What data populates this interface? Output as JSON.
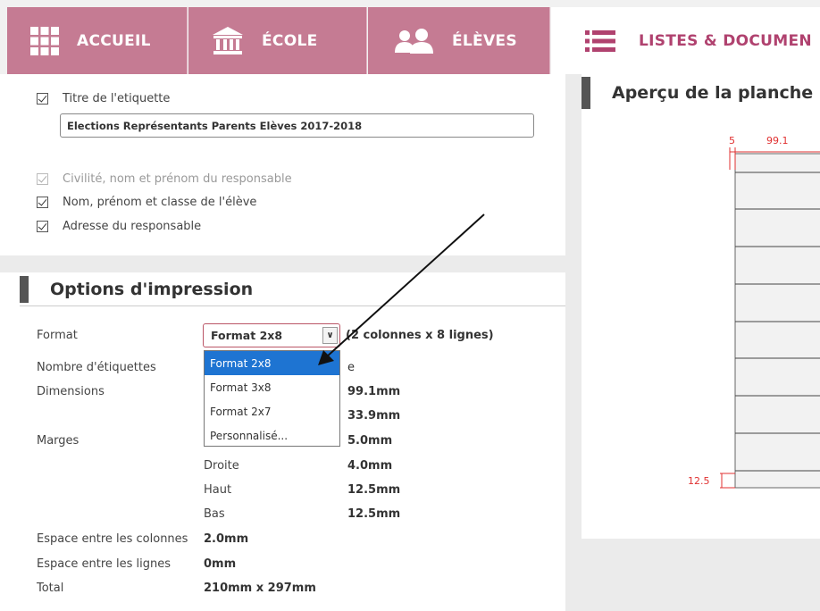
{
  "nav": {
    "accueil": "ACCUEIL",
    "ecole": "ÉCOLE",
    "eleves": "ÉLÈVES",
    "listes": "LISTES & DOCUMEN"
  },
  "label_options": {
    "title_label": "Titre de l'etiquette",
    "title_value": "Elections Représentants Parents Elèves 2017-2018",
    "opt_civilite": "Civilité, nom et prénom du responsable",
    "opt_nom": "Nom, prénom et classe de l'élève",
    "opt_adresse": "Adresse du responsable"
  },
  "print_options": {
    "heading": "Options d'impression",
    "format_label": "Format",
    "format_selected": "Format 2x8",
    "format_desc": "(2 colonnes x 8 lignes)",
    "format_options": [
      "Format 2x8",
      "Format 3x8",
      "Format 2x7",
      "Personnalisé..."
    ],
    "count_label": "Nombre d'étiquettes",
    "count_suffix": "e",
    "dimensions_label": "Dimensions",
    "dim_width": "99.1mm",
    "dim_height": "33.9mm",
    "marges_label": "Marges",
    "margin_left": "5.0mm",
    "droite_label": "Droite",
    "margin_right": "4.0mm",
    "haut_label": "Haut",
    "margin_top": "12.5mm",
    "bas_label": "Bas",
    "margin_bottom": "12.5mm",
    "col_gap_label": "Espace entre les colonnes",
    "col_gap": "2.0mm",
    "row_gap_label": "Espace entre les lignes",
    "row_gap": "0mm",
    "total_label": "Total",
    "total": "210mm x 297mm"
  },
  "preview": {
    "heading": "Aperçu de la planche",
    "dim_margin_left": "5",
    "dim_label_width": "99.1",
    "dim_margin_bottom": "12.5"
  },
  "colors": {
    "nav_pink": "#c57b93",
    "active_text": "#b0426f",
    "select_blue": "#1e74d2",
    "preview_red": "#e03030"
  }
}
